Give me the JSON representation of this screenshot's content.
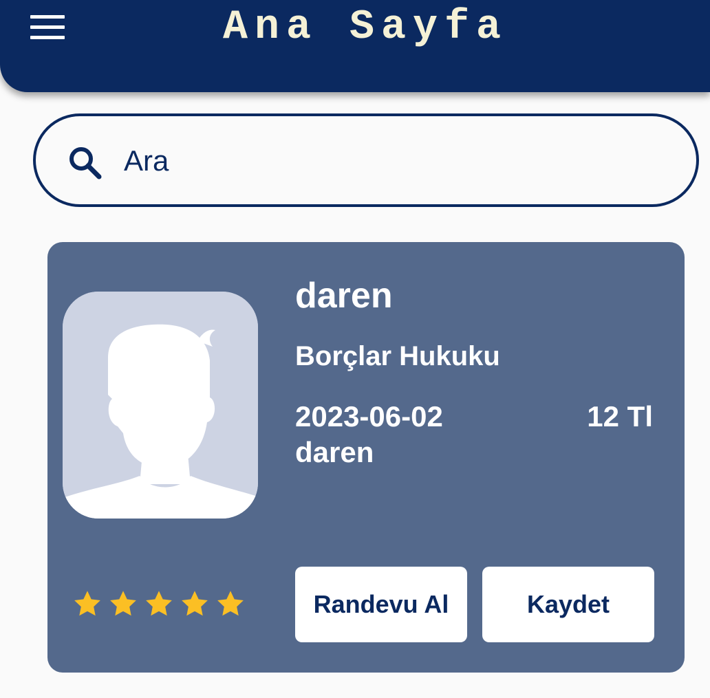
{
  "app_bar": {
    "title": "Ana Sayfa",
    "menu_icon": "hamburger-menu-icon",
    "background_color": "#0b2960",
    "title_color": "#f5f1d6"
  },
  "search": {
    "icon": "search-icon",
    "placeholder": "Ara",
    "value": ""
  },
  "lawyer_card": {
    "name": "daren",
    "specialty": "Borçlar Hukuku",
    "date": "2023-06-02",
    "secondary_name": "daren",
    "price": "12 Tl",
    "avatar_icon": "default-person-avatar",
    "rating": 5,
    "rating_max": 5,
    "star_color": "#fbbf24",
    "card_color": "#54698c",
    "buttons": {
      "appointment_label": "Randevu Al",
      "save_label": "Kaydet"
    }
  }
}
